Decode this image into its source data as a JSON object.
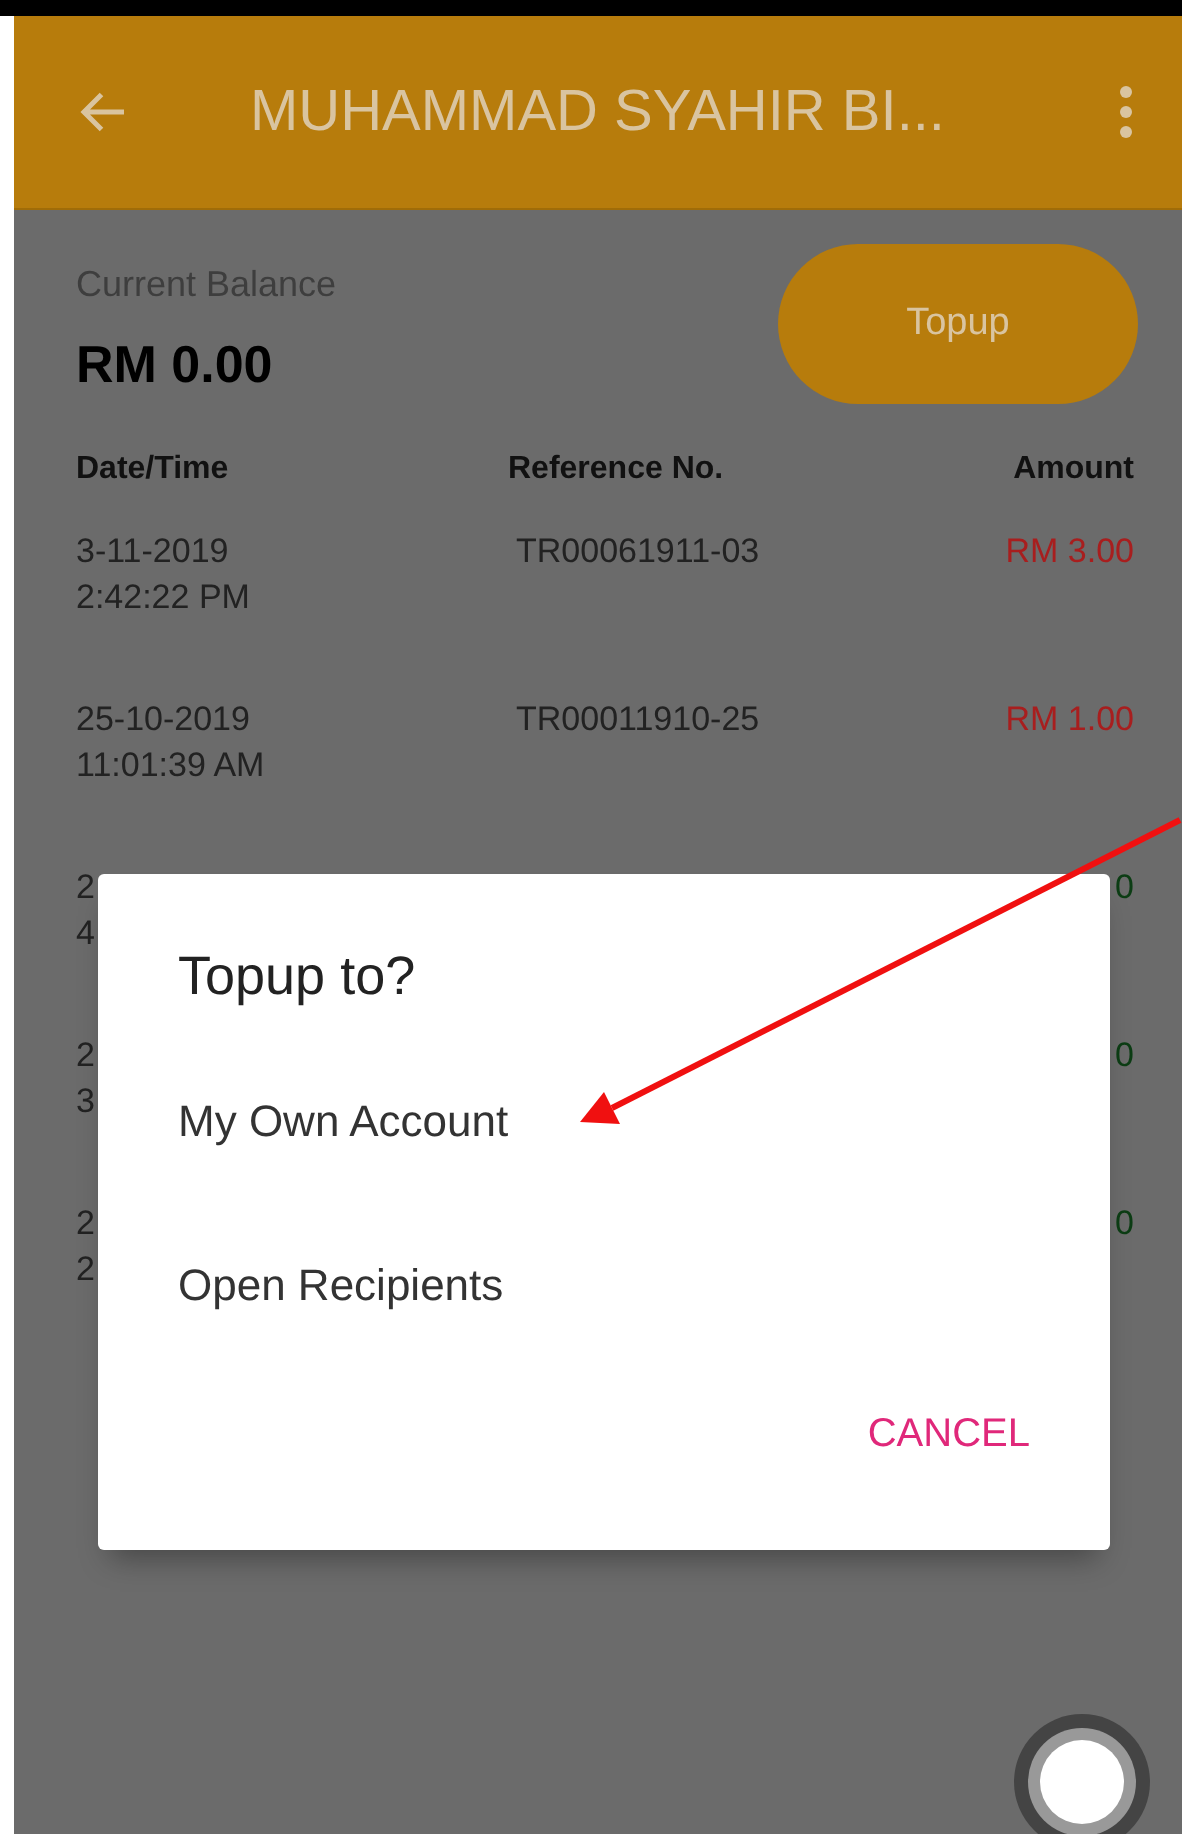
{
  "app_bar": {
    "title": "MUHAMMAD SYAHIR BI..."
  },
  "balance": {
    "label": "Current Balance",
    "amount": "RM 0.00"
  },
  "topup_button": {
    "label": "Topup"
  },
  "table": {
    "columns": [
      "Date/Time",
      "Reference No.",
      "Amount"
    ],
    "rows": [
      {
        "kind": "debit",
        "date": "3-11-2019",
        "time": "2:42:22 PM",
        "reference": "TR00061911-03",
        "amount": "RM 3.00"
      },
      {
        "kind": "debit",
        "date": "25-10-2019",
        "time": "11:01:39 AM",
        "reference": "TR00011910-25",
        "amount": "RM 1.00"
      },
      {
        "kind": "credit",
        "date": "2",
        "time": "4",
        "amount": "0"
      },
      {
        "kind": "credit",
        "date": "2",
        "time": "3",
        "amount": "0"
      },
      {
        "kind": "credit",
        "date": "2",
        "time": "2",
        "amount": "0"
      }
    ]
  },
  "dialog": {
    "title": "Topup to?",
    "options": [
      "My Own Account",
      "Open Recipients"
    ],
    "action": "CANCEL"
  }
}
